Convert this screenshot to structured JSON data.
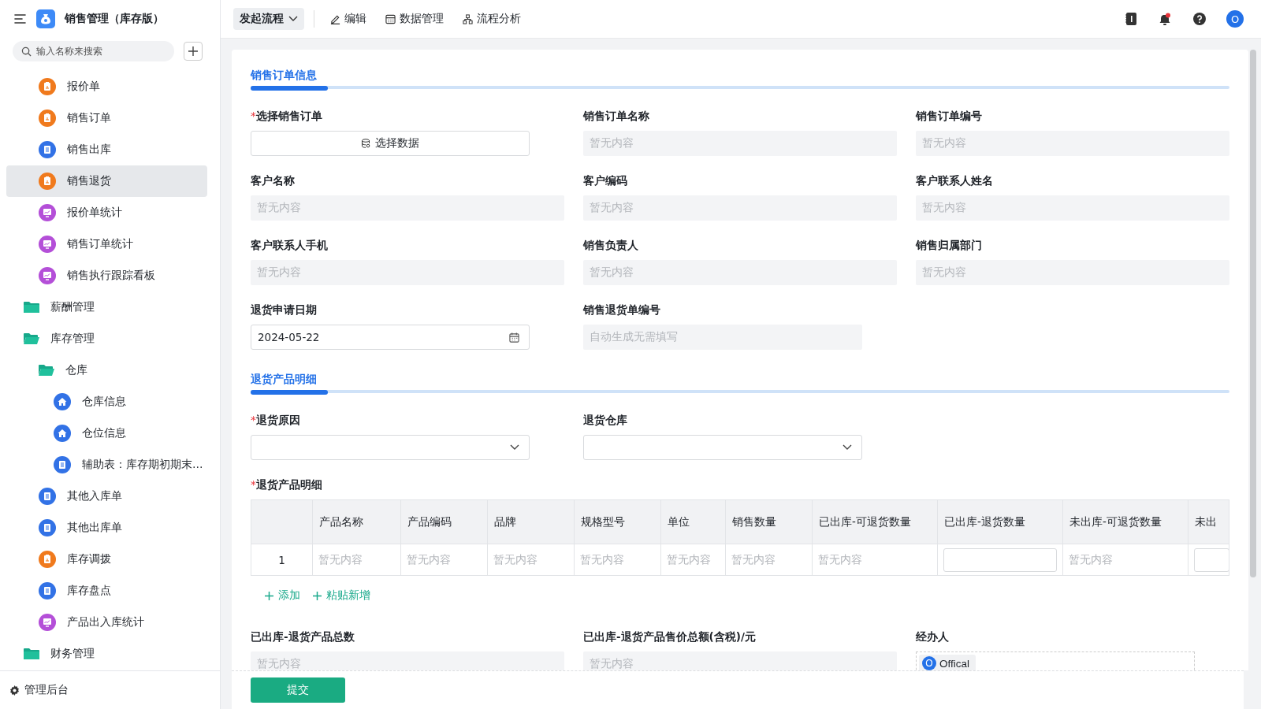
{
  "app": {
    "title": "销售管理（库存版）"
  },
  "search": {
    "placeholder": "输入名称来搜索"
  },
  "sidebar": {
    "items_continued": [
      {
        "label": "报价单",
        "kind": "approval",
        "selected": false
      },
      {
        "label": "销售订单",
        "kind": "approval",
        "selected": false
      },
      {
        "label": "销售出库",
        "kind": "doc",
        "selected": false
      },
      {
        "label": "销售退货",
        "kind": "approval",
        "selected": true
      },
      {
        "label": "报价单统计",
        "kind": "report",
        "selected": false
      },
      {
        "label": "销售订单统计",
        "kind": "report",
        "selected": false
      },
      {
        "label": "销售执行跟踪看板",
        "kind": "report",
        "selected": false
      }
    ],
    "items": [
      {
        "label": "薪酬管理",
        "kind": "folder",
        "expanded": false,
        "selected": false
      },
      {
        "label": "库存管理",
        "kind": "folder",
        "expanded": true,
        "selected": false,
        "children": [
          {
            "label": "仓库",
            "kind": "folder",
            "expanded": true,
            "selected": false,
            "children": [
              {
                "label": "仓库信息",
                "kind": "house",
                "selected": false
              },
              {
                "label": "仓位信息",
                "kind": "house",
                "selected": false
              },
              {
                "label": "辅助表：库存期初期末…",
                "kind": "doc",
                "selected": false
              }
            ]
          },
          {
            "label": "其他入库单",
            "kind": "doc",
            "selected": false
          },
          {
            "label": "其他出库单",
            "kind": "doc",
            "selected": false
          },
          {
            "label": "库存调拨",
            "kind": "approval",
            "selected": false
          },
          {
            "label": "库存盘点",
            "kind": "doc",
            "selected": false
          },
          {
            "label": "产品出入库统计",
            "kind": "report",
            "selected": false
          }
        ]
      },
      {
        "label": "财务管理",
        "kind": "folder",
        "expanded": false,
        "selected": false
      }
    ],
    "footer": "管理后台"
  },
  "toolbar": {
    "start_button": "发起流程",
    "actions": [
      {
        "label": "编辑",
        "kind": "edit"
      },
      {
        "label": "数据管理",
        "kind": "table"
      },
      {
        "label": "流程分析",
        "kind": "flow"
      }
    ]
  },
  "header_right": {
    "notifications": true,
    "avatar": "O"
  },
  "sections": [
    {
      "title": "销售订单信息",
      "fields": [
        {
          "label": "选择销售订单",
          "marker": "*",
          "kind": "picker",
          "button": "选择数据"
        },
        {
          "label": "销售订单名称",
          "kind": "readonly",
          "placeholder": "暂无内容"
        },
        {
          "label": "销售订单编号",
          "kind": "readonly",
          "placeholder": "暂无内容"
        },
        {
          "label": "客户名称",
          "kind": "readonly",
          "placeholder": "暂无内容"
        },
        {
          "label": "客户编码",
          "kind": "readonly",
          "placeholder": "暂无内容"
        },
        {
          "label": "客户联系人姓名",
          "kind": "readonly",
          "placeholder": "暂无内容"
        },
        {
          "label": "客户联系人手机",
          "kind": "readonly",
          "placeholder": "暂无内容"
        },
        {
          "label": "销售负责人",
          "kind": "readonly",
          "placeholder": "暂无内容"
        },
        {
          "label": "销售归属部门",
          "kind": "readonly",
          "placeholder": "暂无内容"
        },
        {
          "label": "退货申请日期",
          "kind": "date",
          "value": "2024-05-22"
        },
        {
          "label": "销售退货单编号",
          "kind": "readonly-short",
          "placeholder": "自动生成无需填写"
        }
      ]
    },
    {
      "title": "退货产品明细",
      "fields": [
        {
          "label": "退货原因",
          "marker": "*",
          "kind": "dropdown"
        },
        {
          "label": "退货仓库",
          "kind": "dropdown"
        },
        {
          "label": "退货产品明细",
          "marker": "*",
          "kind": "table",
          "columns": [
            "产品名称",
            "产品编码",
            "品牌",
            "规格型号",
            "单位",
            "销售数量",
            "已出库-可退货数量",
            "已出库-退货数量",
            "未出库-可退货数量",
            "未出"
          ],
          "rows": [
            {
              "index": "1",
              "cells": [
                {
                  "kind": "text",
                  "text": "暂无内容"
                },
                {
                  "kind": "text",
                  "text": "暂无内容"
                },
                {
                  "kind": "text",
                  "text": "暂无内容"
                },
                {
                  "kind": "text",
                  "text": "暂无内容"
                },
                {
                  "kind": "text",
                  "text": "暂无内容"
                },
                {
                  "kind": "text",
                  "text": "暂无内容"
                },
                {
                  "kind": "text",
                  "text": "暂无内容"
                },
                {
                  "kind": "input"
                },
                {
                  "kind": "text",
                  "text": "暂无内容"
                },
                {
                  "kind": "input"
                }
              ]
            }
          ],
          "actions": [
            "添加",
            "粘贴新增"
          ]
        },
        {
          "label": "已出库-退货产品总数",
          "kind": "readonly",
          "placeholder": "暂无内容"
        },
        {
          "label": "已出库-退货产品售价总额(含税)/元",
          "kind": "readonly",
          "placeholder": "暂无内容"
        },
        {
          "label": "经办人",
          "kind": "user",
          "user": {
            "initial": "O",
            "name": "Offical"
          }
        }
      ]
    }
  ],
  "submit": "提交"
}
